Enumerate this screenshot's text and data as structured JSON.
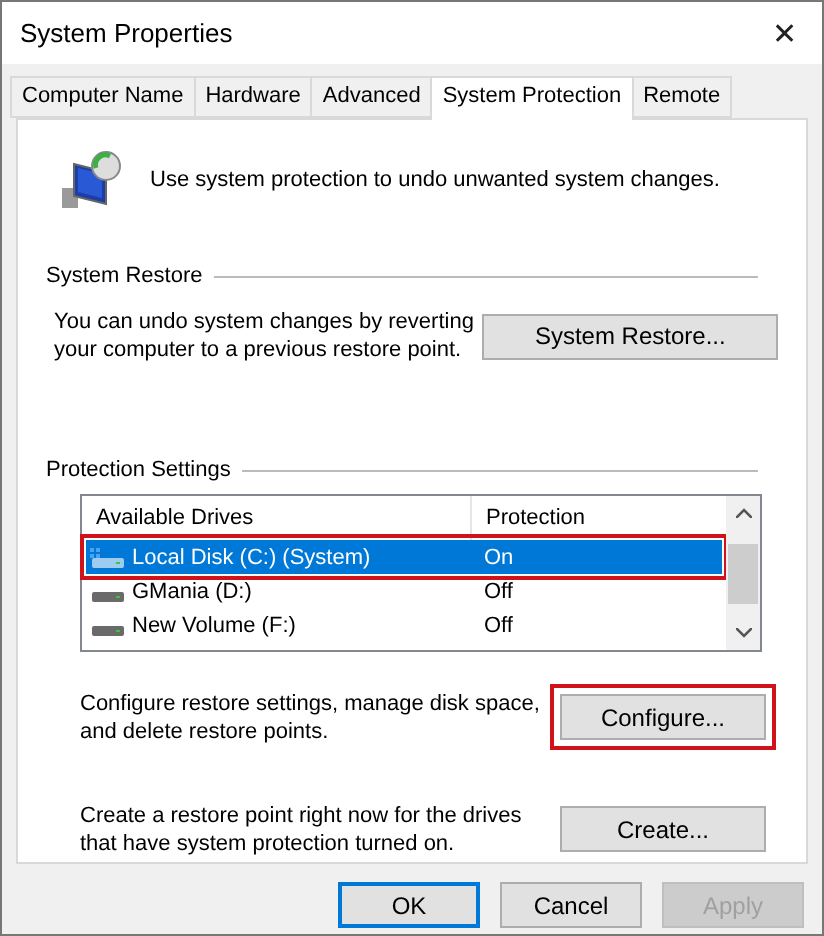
{
  "window": {
    "title": "System Properties",
    "close": "✕"
  },
  "tabs": [
    {
      "label": "Computer Name",
      "selected": false
    },
    {
      "label": "Hardware",
      "selected": false
    },
    {
      "label": "Advanced",
      "selected": false
    },
    {
      "label": "System Protection",
      "selected": true
    },
    {
      "label": "Remote",
      "selected": false
    }
  ],
  "intro": "Use system protection to undo unwanted system changes.",
  "system_restore": {
    "title": "System Restore",
    "description": "You can undo system changes by reverting your computer to a previous restore point.",
    "button": "System Restore..."
  },
  "protection_settings": {
    "title": "Protection Settings",
    "columns": [
      "Available Drives",
      "Protection"
    ],
    "drives": [
      {
        "name": "Local Disk (C:) (System)",
        "protection": "On",
        "kind": "system",
        "selected": true,
        "highlighted": true
      },
      {
        "name": "GMania (D:)",
        "protection": "Off",
        "kind": "disk",
        "selected": false,
        "highlighted": false
      },
      {
        "name": "New Volume (F:)",
        "protection": "Off",
        "kind": "disk",
        "selected": false,
        "highlighted": false
      }
    ],
    "configure": {
      "text": "Configure restore settings, manage disk space, and delete restore points.",
      "button": "Configure...",
      "highlighted": true
    },
    "create": {
      "text": "Create a restore point right now for the drives that have system protection turned on.",
      "button": "Create...",
      "highlighted": false
    }
  },
  "buttons": [
    {
      "label": "OK",
      "default": true,
      "disabled": false
    },
    {
      "label": "Cancel",
      "default": false,
      "disabled": false
    },
    {
      "label": "Apply",
      "default": false,
      "disabled": true
    }
  ]
}
